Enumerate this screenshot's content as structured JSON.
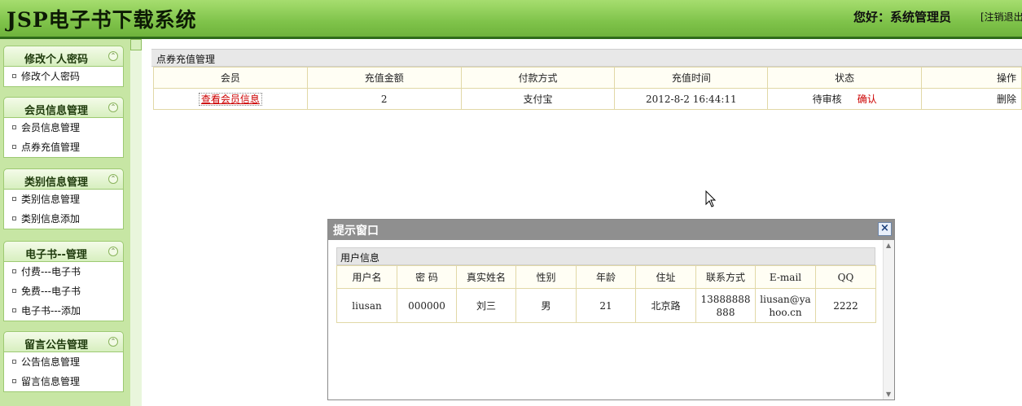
{
  "header": {
    "title": "JSP电子书下载系统",
    "greeting": "您好：系统管理员",
    "logout": "[注销退出"
  },
  "sidebar": {
    "sections": [
      {
        "title": "修改个人密码",
        "items": [
          "修改个人密码"
        ]
      },
      {
        "title": "会员信息管理",
        "items": [
          "会员信息管理",
          "点券充值管理"
        ]
      },
      {
        "title": "类别信息管理",
        "items": [
          "类别信息管理",
          "类别信息添加"
        ]
      },
      {
        "title": "电子书--管理",
        "items": [
          "付费---电子书",
          "免费---电子书",
          "电子书---添加"
        ]
      },
      {
        "title": "留言公告管理",
        "items": [
          "公告信息管理",
          "留言信息管理"
        ]
      }
    ]
  },
  "main": {
    "title": "点券充值管理",
    "columns": [
      "会员",
      "充值金额",
      "付款方式",
      "充值时间",
      "状态",
      "操作"
    ],
    "rows": [
      {
        "member": "查看会员信息",
        "amount": "2",
        "payment": "支付宝",
        "time": "2012-8-2 16:44:11",
        "status": "待审核",
        "confirm": "确认",
        "delete": "删除"
      }
    ]
  },
  "popup": {
    "title": "提示窗口",
    "close": "×",
    "section_title": "用户信息",
    "columns": [
      "用户名",
      "密 码",
      "真实姓名",
      "性别",
      "年龄",
      "住址",
      "联系方式",
      "E-mail",
      "QQ"
    ],
    "row": {
      "username": "liusan",
      "password": "000000",
      "realname": "刘三",
      "gender": "男",
      "age": "21",
      "address": "北京路",
      "phone": "13888888888",
      "email": "liusan@yahoo.cn",
      "qq": "2222"
    }
  },
  "colors": {
    "header_green": "#7fc34a",
    "sidebar_bg": "#c7e6a4",
    "link_red": "#cc0000",
    "popup_title_bg": "#8f8f8f"
  }
}
